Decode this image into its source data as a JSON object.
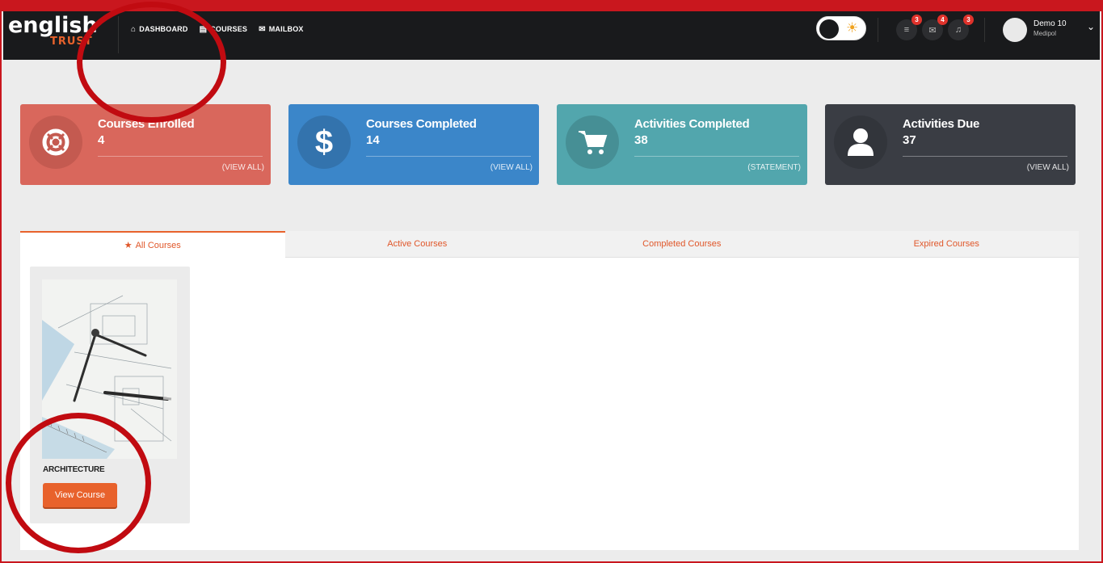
{
  "brand": {
    "word": "english",
    "sub": "TRUST"
  },
  "nav": [
    {
      "label": "DASHBOARD",
      "icon": "home-icon"
    },
    {
      "label": "COURSES",
      "icon": "courses-icon"
    },
    {
      "label": "MAILBOX",
      "icon": "mail-icon"
    }
  ],
  "header": {
    "badges": {
      "tasks": "3",
      "mail": "4",
      "notifications": "3"
    },
    "user_name": "Demo 10",
    "user_org": "Medipol"
  },
  "cards": [
    {
      "title": "Courses Enrolled",
      "count": "4",
      "link": "(VIEW ALL)",
      "color": "#d9675c",
      "icon": "lifebuoy-icon"
    },
    {
      "title": "Courses Completed",
      "count": "14",
      "link": "(VIEW ALL)",
      "color": "#3b86c9",
      "icon": "dollar-icon"
    },
    {
      "title": "Activities Completed",
      "count": "38",
      "link": "(STATEMENT)",
      "color": "#52a6ad",
      "icon": "cart-icon"
    },
    {
      "title": "Activities Due",
      "count": "37",
      "link": "(VIEW ALL)",
      "color": "#3a3d44",
      "icon": "user-icon"
    }
  ],
  "tabs": [
    "All Courses",
    "Active Courses",
    "Completed Courses",
    "Expired Courses"
  ],
  "course": {
    "name": "ARCHITECTURE",
    "button": "View Course"
  },
  "colors": {
    "accent": "#e8622c",
    "topbar": "#191a1c",
    "annotation": "#c10b11"
  }
}
